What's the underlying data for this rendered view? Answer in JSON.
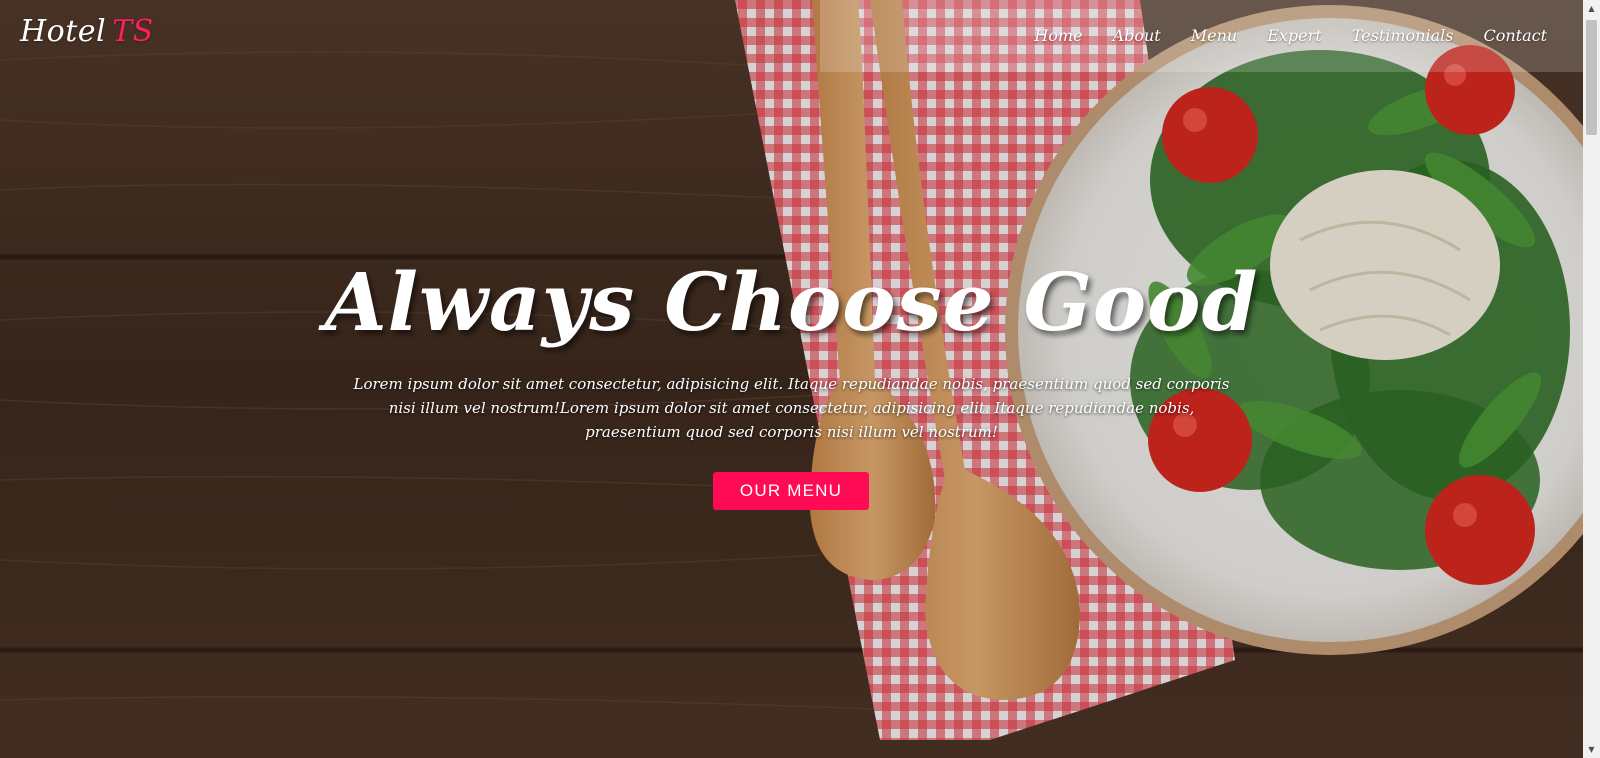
{
  "brand": {
    "name": "Hotel",
    "accent": "TS"
  },
  "nav": {
    "items": [
      "Home",
      "About",
      "Menu",
      "Expert",
      "Testimonials",
      "Contact"
    ]
  },
  "hero": {
    "title": "Always Choose Good",
    "text": "Lorem ipsum dolor sit amet consectetur, adipisicing elit. Itaque repudiandae nobis, praesentium quod sed corporis nisi illum vel nostrum!Lorem ipsum dolor sit amet consectetur, adipisicing elit. Itaque repudiandae nobis, praesentium quod sed corporis nisi illum vel nostrum!",
    "button": "OUR MENU"
  },
  "scrollbar": {
    "up_icon": "triangle-up",
    "down_icon": "triangle-down"
  },
  "colors": {
    "accent": "#ff0a55",
    "brand_accent": "#ff1e5e",
    "wood": "#4a3325",
    "tablecloth": "#d8202e"
  }
}
